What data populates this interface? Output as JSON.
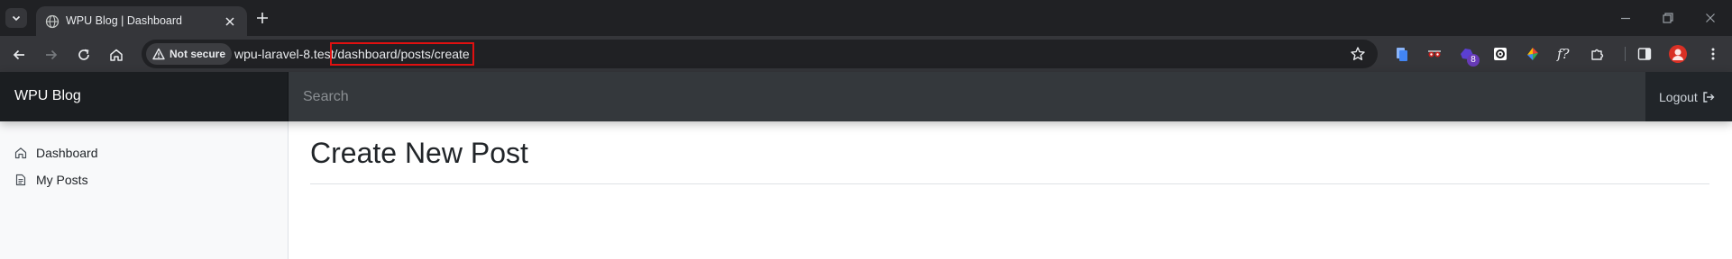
{
  "browser": {
    "tab": {
      "title": "WPU Blog | Dashboard"
    },
    "security": {
      "label": "Not secure"
    },
    "url": {
      "host": "wpu-laravel-8.test",
      "path": "/dashboard/posts/create"
    },
    "extensions": [
      {
        "icon": "document-extension-icon",
        "badge": ""
      },
      {
        "icon": "glasses-extension-icon",
        "badge": ""
      },
      {
        "icon": "purple-extension-icon",
        "badge": "8"
      },
      {
        "icon": "gear-box-extension-icon",
        "badge": ""
      },
      {
        "icon": "color-wheel-extension-icon",
        "badge": ""
      },
      {
        "icon": "fx-extension-icon",
        "badge": ""
      }
    ]
  },
  "app": {
    "brand": "WPU Blog",
    "search": {
      "placeholder": "Search",
      "value": ""
    },
    "logout_label": "Logout",
    "sidebar": {
      "items": [
        {
          "label": "Dashboard",
          "icon": "home-icon"
        },
        {
          "label": "My Posts",
          "icon": "file-text-icon"
        }
      ]
    },
    "main": {
      "title": "Create New Post"
    }
  },
  "colors": {
    "navbar": "#212529",
    "brand_bg": "#1b1e21",
    "search_bg": "#34383c",
    "sidebar_bg": "#f8f9fa",
    "highlight_box": "#e01010"
  }
}
